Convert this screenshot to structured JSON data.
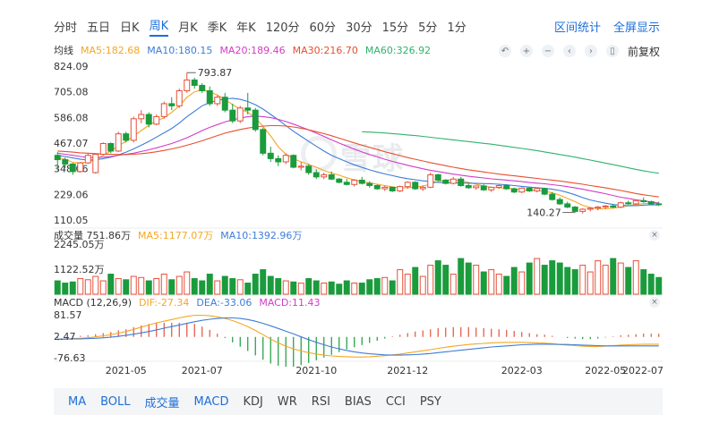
{
  "period_tabs": [
    "分时",
    "五日",
    "日K",
    "周K",
    "月K",
    "季K",
    "年K",
    "120分",
    "60分",
    "30分",
    "15分",
    "5分",
    "1分"
  ],
  "active_tab": "周K",
  "right_tabs": [
    "区间统计",
    "全屏显示"
  ],
  "ma_legend": {
    "label": "均线",
    "items": [
      {
        "text": "MA5:182.68",
        "color": "#f5a623"
      },
      {
        "text": "MA10:180.15",
        "color": "#3d7dd8"
      },
      {
        "text": "MA20:189.46",
        "color": "#d33cc6"
      },
      {
        "text": "MA30:216.70",
        "color": "#e5502e"
      },
      {
        "text": "MA60:326.92",
        "color": "#2fb36b"
      }
    ]
  },
  "adjust_label": "前复权",
  "watermark": "雪球",
  "vol_legend": {
    "label": "成交量 751.86万",
    "items": [
      {
        "text": "MA5:1177.07万",
        "color": "#f5a623"
      },
      {
        "text": "MA10:1392.96万",
        "color": "#3d7dd8"
      }
    ]
  },
  "macd_legend": {
    "label": "MACD (12,26,9)",
    "items": [
      {
        "text": "DIF:-27.34",
        "color": "#f5a623"
      },
      {
        "text": "DEA:-33.06",
        "color": "#3d7dd8"
      },
      {
        "text": "MACD:11.43",
        "color": "#d33cc6"
      }
    ]
  },
  "bottom_tabs": [
    "MA",
    "BOLL",
    "成交量",
    "MACD",
    "KDJ",
    "WR",
    "RSI",
    "BIAS",
    "CCI",
    "PSY"
  ],
  "bottom_active": [
    "MA",
    "BOLL",
    "成交量",
    "MACD"
  ],
  "colors": {
    "up": "#e5503a",
    "down": "#1a9b3c",
    "accent": "#1e6fd9"
  },
  "chart_data": {
    "type": "candlestick",
    "price_axis": {
      "ticks": [
        "824.09",
        "705.08",
        "586.08",
        "467.07",
        "348.06",
        "229.06",
        "110.05"
      ],
      "ylim": [
        110.05,
        824.09
      ]
    },
    "x_ticks": [
      "2021-05",
      "2021-07",
      "2021-10",
      "2021-12",
      "2022-03",
      "2022-05",
      "2022-07"
    ],
    "annotations": {
      "high": "793.87",
      "low": "140.27"
    },
    "candles": [
      [
        410,
        425,
        340,
        390
      ],
      [
        390,
        400,
        350,
        370
      ],
      [
        370,
        375,
        320,
        335
      ],
      [
        335,
        380,
        330,
        375
      ],
      [
        375,
        420,
        370,
        410
      ],
      [
        330,
        420,
        325,
        415
      ],
      [
        415,
        470,
        410,
        465
      ],
      [
        465,
        470,
        420,
        430
      ],
      [
        430,
        520,
        425,
        510
      ],
      [
        510,
        520,
        470,
        480
      ],
      [
        480,
        590,
        470,
        580
      ],
      [
        580,
        620,
        560,
        600
      ],
      [
        600,
        610,
        540,
        555
      ],
      [
        555,
        600,
        550,
        590
      ],
      [
        590,
        660,
        580,
        650
      ],
      [
        650,
        680,
        620,
        640
      ],
      [
        640,
        720,
        630,
        710
      ],
      [
        710,
        794,
        700,
        760
      ],
      [
        760,
        770,
        720,
        735
      ],
      [
        735,
        745,
        700,
        710
      ],
      [
        710,
        730,
        640,
        650
      ],
      [
        650,
        690,
        640,
        680
      ],
      [
        680,
        700,
        610,
        620
      ],
      [
        620,
        650,
        560,
        570
      ],
      [
        570,
        640,
        560,
        630
      ],
      [
        630,
        700,
        600,
        620
      ],
      [
        620,
        630,
        520,
        530
      ],
      [
        530,
        540,
        410,
        420
      ],
      [
        420,
        450,
        380,
        395
      ],
      [
        395,
        410,
        360,
        380
      ],
      [
        380,
        420,
        370,
        410
      ],
      [
        410,
        415,
        350,
        355
      ],
      [
        355,
        380,
        340,
        360
      ],
      [
        360,
        370,
        320,
        330
      ],
      [
        330,
        345,
        300,
        310
      ],
      [
        310,
        330,
        300,
        320
      ],
      [
        320,
        335,
        295,
        300
      ],
      [
        300,
        305,
        280,
        285
      ],
      [
        285,
        300,
        270,
        275
      ],
      [
        275,
        300,
        265,
        295
      ],
      [
        295,
        310,
        275,
        280
      ],
      [
        280,
        290,
        260,
        270
      ],
      [
        270,
        275,
        250,
        255
      ],
      [
        255,
        270,
        245,
        262
      ],
      [
        262,
        265,
        240,
        245
      ],
      [
        245,
        270,
        240,
        265
      ],
      [
        265,
        290,
        255,
        285
      ],
      [
        285,
        290,
        250,
        255
      ],
      [
        255,
        270,
        245,
        262
      ],
      [
        262,
        330,
        258,
        320
      ],
      [
        320,
        325,
        290,
        295
      ],
      [
        295,
        300,
        275,
        280
      ],
      [
        280,
        310,
        275,
        300
      ],
      [
        300,
        310,
        265,
        270
      ],
      [
        270,
        280,
        255,
        260
      ],
      [
        260,
        270,
        250,
        268
      ],
      [
        268,
        275,
        245,
        250
      ],
      [
        250,
        265,
        240,
        262
      ],
      [
        262,
        275,
        255,
        270
      ],
      [
        270,
        275,
        250,
        255
      ],
      [
        255,
        260,
        235,
        240
      ],
      [
        240,
        262,
        235,
        258
      ],
      [
        258,
        262,
        240,
        245
      ],
      [
        245,
        260,
        238,
        256
      ],
      [
        256,
        260,
        225,
        230
      ],
      [
        230,
        240,
        200,
        205
      ],
      [
        205,
        215,
        180,
        185
      ],
      [
        185,
        195,
        165,
        170
      ],
      [
        170,
        175,
        145,
        150
      ],
      [
        150,
        165,
        140,
        160
      ],
      [
        160,
        170,
        150,
        165
      ],
      [
        165,
        175,
        155,
        170
      ],
      [
        170,
        180,
        160,
        175
      ],
      [
        175,
        185,
        165,
        170
      ],
      [
        170,
        195,
        165,
        190
      ],
      [
        190,
        200,
        180,
        185
      ],
      [
        185,
        205,
        180,
        200
      ],
      [
        200,
        215,
        190,
        195
      ],
      [
        195,
        200,
        180,
        185
      ],
      [
        185,
        195,
        175,
        182
      ]
    ],
    "ma": {
      "MA5": [
        400,
        392,
        378,
        375,
        380,
        390,
        410,
        430,
        455,
        475,
        500,
        525,
        550,
        570,
        585,
        610,
        640,
        680,
        705,
        715,
        705,
        690,
        670,
        645,
        625,
        610,
        585,
        545,
        500,
        450,
        415,
        395,
        380,
        368,
        355,
        340,
        328,
        318,
        306,
        296,
        288,
        282,
        276,
        270,
        264,
        260,
        260,
        264,
        268,
        276,
        288,
        295,
        297,
        292,
        285,
        276,
        268,
        262,
        260,
        258,
        254,
        250,
        248,
        246,
        244,
        236,
        225,
        210,
        195,
        178,
        168,
        162,
        162,
        165,
        170,
        176,
        182,
        186,
        188,
        186
      ],
      "MA10": [
        410,
        405,
        398,
        392,
        388,
        390,
        395,
        402,
        412,
        425,
        440,
        457,
        475,
        495,
        515,
        535,
        560,
        590,
        615,
        640,
        655,
        665,
        672,
        675,
        670,
        660,
        645,
        625,
        600,
        575,
        548,
        522,
        498,
        475,
        452,
        430,
        410,
        395,
        380,
        366,
        354,
        343,
        333,
        324,
        316,
        308,
        302,
        297,
        292,
        288,
        285,
        283,
        283,
        282,
        281,
        280,
        279,
        278,
        276,
        273,
        270,
        266,
        263,
        260,
        257,
        253,
        247,
        238,
        227,
        214,
        203,
        195,
        188,
        182,
        178,
        176,
        177,
        179,
        181,
        180
      ],
      "MA20": [
        420,
        415,
        410,
        405,
        400,
        400,
        402,
        405,
        410,
        415,
        420,
        428,
        436,
        445,
        455,
        465,
        478,
        492,
        508,
        525,
        540,
        553,
        565,
        575,
        583,
        590,
        592,
        590,
        585,
        577,
        567,
        555,
        542,
        528,
        513,
        498,
        482,
        467,
        453,
        439,
        426,
        414,
        403,
        392,
        382,
        373,
        364,
        356,
        348,
        341,
        335,
        329,
        323,
        318,
        313,
        309,
        305,
        301,
        298,
        295,
        292,
        288,
        284,
        281,
        278,
        274,
        270,
        265,
        259,
        253,
        246,
        239,
        232,
        224,
        216,
        210,
        204,
        199,
        194,
        189
      ],
      "MA30": [
        430,
        428,
        425,
        422,
        420,
        418,
        416,
        415,
        414,
        414,
        415,
        418,
        422,
        427,
        433,
        440,
        448,
        457,
        467,
        478,
        490,
        502,
        513,
        522,
        530,
        537,
        542,
        546,
        548,
        548,
        546,
        542,
        536,
        529,
        520,
        511,
        501,
        490,
        479,
        468,
        457,
        447,
        437,
        427,
        418,
        409,
        400,
        392,
        384,
        376,
        369,
        362,
        355,
        349,
        343,
        338,
        333,
        328,
        323,
        319,
        315,
        311,
        307,
        303,
        299,
        295,
        291,
        286,
        281,
        276,
        270,
        265,
        259,
        253,
        247,
        240,
        233,
        227,
        222,
        217
      ],
      "MA60": [
        null,
        null,
        null,
        null,
        null,
        null,
        null,
        null,
        null,
        null,
        null,
        null,
        null,
        null,
        null,
        null,
        null,
        null,
        null,
        null,
        null,
        null,
        null,
        null,
        null,
        null,
        null,
        null,
        null,
        null,
        null,
        null,
        null,
        null,
        null,
        null,
        null,
        null,
        null,
        null,
        520,
        518,
        516,
        514,
        511,
        508,
        505,
        502,
        498,
        494,
        490,
        486,
        482,
        478,
        474,
        470,
        466,
        462,
        457,
        452,
        447,
        442,
        437,
        432,
        426,
        420,
        414,
        408,
        402,
        395,
        388,
        381,
        374,
        367,
        360,
        352,
        345,
        338,
        332,
        327
      ]
    },
    "volume_axis": {
      "ticks": [
        "2245.05万",
        "1122.52万"
      ],
      "ylim": [
        0,
        2245.05
      ]
    },
    "volume": [
      600,
      500,
      550,
      700,
      650,
      800,
      600,
      900,
      700,
      650,
      800,
      750,
      600,
      700,
      900,
      650,
      800,
      1000,
      700,
      600,
      900,
      600,
      800,
      700,
      650,
      500,
      900,
      1100,
      800,
      700,
      600,
      550,
      500,
      700,
      600,
      500,
      550,
      450,
      600,
      500,
      500,
      650,
      700,
      750,
      600,
      1100,
      900,
      1200,
      800,
      1300,
      1500,
      1300,
      900,
      1600,
      1400,
      1300,
      1000,
      1100,
      900,
      800,
      1200,
      1000,
      1400,
      1600,
      1300,
      1500,
      1400,
      1200,
      1100,
      1300,
      1000,
      1500,
      1300,
      1600,
      1400,
      1200,
      1500,
      1100,
      900,
      750
    ],
    "macd_axis": {
      "ticks": [
        "81.57",
        "2.47",
        "-76.63"
      ],
      "ylim": [
        -76.63,
        81.57
      ]
    },
    "dif": [
      -10,
      -8,
      -6,
      -5,
      -3,
      0,
      4,
      8,
      14,
      20,
      28,
      36,
      44,
      52,
      58,
      64,
      70,
      76,
      80,
      80,
      78,
      74,
      68,
      60,
      50,
      38,
      24,
      8,
      -8,
      -22,
      -34,
      -44,
      -52,
      -58,
      -63,
      -67,
      -70,
      -72,
      -73,
      -74,
      -74,
      -73,
      -71,
      -69,
      -66,
      -63,
      -59,
      -55,
      -51,
      -47,
      -42,
      -38,
      -34,
      -31,
      -28,
      -26,
      -24,
      -22,
      -21,
      -20,
      -20,
      -20,
      -21,
      -22,
      -23,
      -25,
      -28,
      -30,
      -32,
      -34,
      -35,
      -35,
      -34,
      -32,
      -30,
      -29,
      -28,
      -27,
      -27,
      -27
    ],
    "dea": [
      -8,
      -8,
      -7,
      -7,
      -6,
      -5,
      -3,
      -1,
      2,
      6,
      10,
      15,
      20,
      26,
      32,
      38,
      44,
      50,
      56,
      61,
      65,
      68,
      70,
      70,
      68,
      64,
      58,
      50,
      41,
      31,
      21,
      11,
      0,
      -10,
      -20,
      -29,
      -37,
      -44,
      -50,
      -55,
      -59,
      -62,
      -64,
      -66,
      -67,
      -67,
      -66,
      -65,
      -63,
      -61,
      -58,
      -55,
      -52,
      -49,
      -46,
      -43,
      -40,
      -37,
      -35,
      -33,
      -31,
      -29,
      -28,
      -27,
      -27,
      -27,
      -28,
      -28,
      -29,
      -30,
      -31,
      -32,
      -33,
      -33,
      -33,
      -33,
      -33,
      -33,
      -33,
      -33
    ],
    "macd": [
      -4,
      0,
      2,
      4,
      6,
      10,
      14,
      18,
      24,
      28,
      36,
      42,
      48,
      52,
      52,
      52,
      52,
      52,
      48,
      38,
      26,
      12,
      -4,
      -20,
      -36,
      -52,
      -68,
      -84,
      -98,
      -106,
      -110,
      -110,
      -104,
      -96,
      -86,
      -76,
      -66,
      -56,
      -46,
      -38,
      -30,
      -22,
      -14,
      -6,
      2,
      8,
      14,
      20,
      24,
      28,
      32,
      34,
      36,
      36,
      36,
      34,
      32,
      30,
      28,
      26,
      22,
      18,
      14,
      10,
      8,
      4,
      0,
      -4,
      -6,
      -8,
      -8,
      -6,
      -2,
      2,
      6,
      8,
      10,
      12,
      12,
      11.43
    ]
  }
}
